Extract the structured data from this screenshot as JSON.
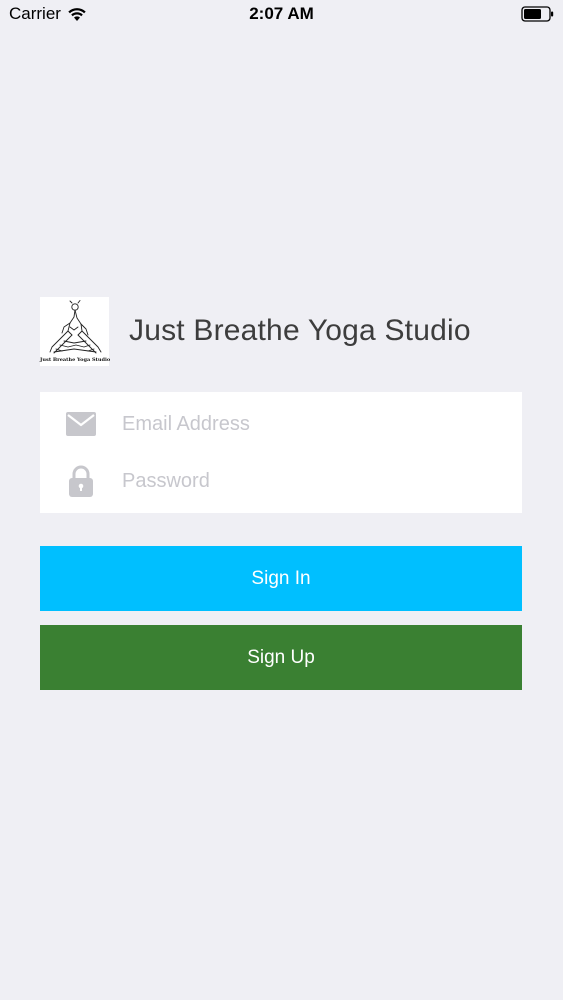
{
  "status_bar": {
    "carrier": "Carrier",
    "time": "2:07 AM",
    "wifi_icon": "wifi-icon",
    "battery_icon": "battery-icon"
  },
  "brand": {
    "title": "Just Breathe Yoga Studio",
    "logo_caption": "Just Breathe Yoga Studio",
    "logo_icon": "yoga-logo-icon"
  },
  "form": {
    "email": {
      "placeholder": "Email Address",
      "value": "",
      "icon": "envelope-icon"
    },
    "password": {
      "placeholder": "Password",
      "value": "",
      "icon": "lock-icon"
    }
  },
  "buttons": {
    "sign_in": "Sign In",
    "sign_up": "Sign Up"
  },
  "colors": {
    "background": "#efeff4",
    "sign_in": "#00bfff",
    "sign_up": "#3a8032",
    "icon_gray": "#c7c7cc"
  }
}
